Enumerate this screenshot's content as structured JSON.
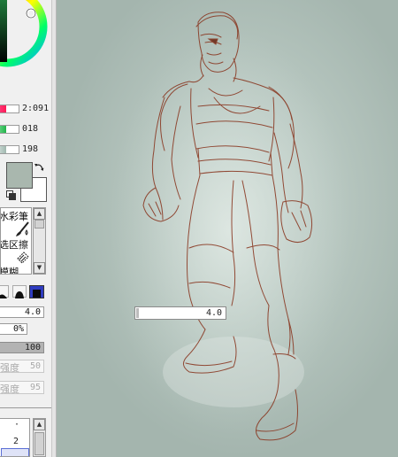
{
  "color_panel": {
    "red_value": "2:091",
    "green_value": "018",
    "blue_value": "198",
    "red_fill": 0.36,
    "green_fill": 0.36,
    "blue_fill": 0.36,
    "foreground_color": "#a9b7ae",
    "background_color": "#ffffff"
  },
  "tools": {
    "item_1": "水彩筆",
    "item_2": "选区擦",
    "item_3": "模糊"
  },
  "brush": {
    "size_value": "4.0",
    "min_size_value": "0%",
    "density_value": "100",
    "density_fill": 1.0,
    "strength_label_1": "强度",
    "strength_value_1": "50",
    "strength_label_2": "强度",
    "strength_value_2": "95"
  },
  "layers": {
    "item_dot": "·",
    "item_number": "2"
  },
  "canvas": {
    "brush_size_popup_value": "4.0",
    "background_color": "#a6b7b0",
    "sketch_color": "#8a3a24"
  }
}
